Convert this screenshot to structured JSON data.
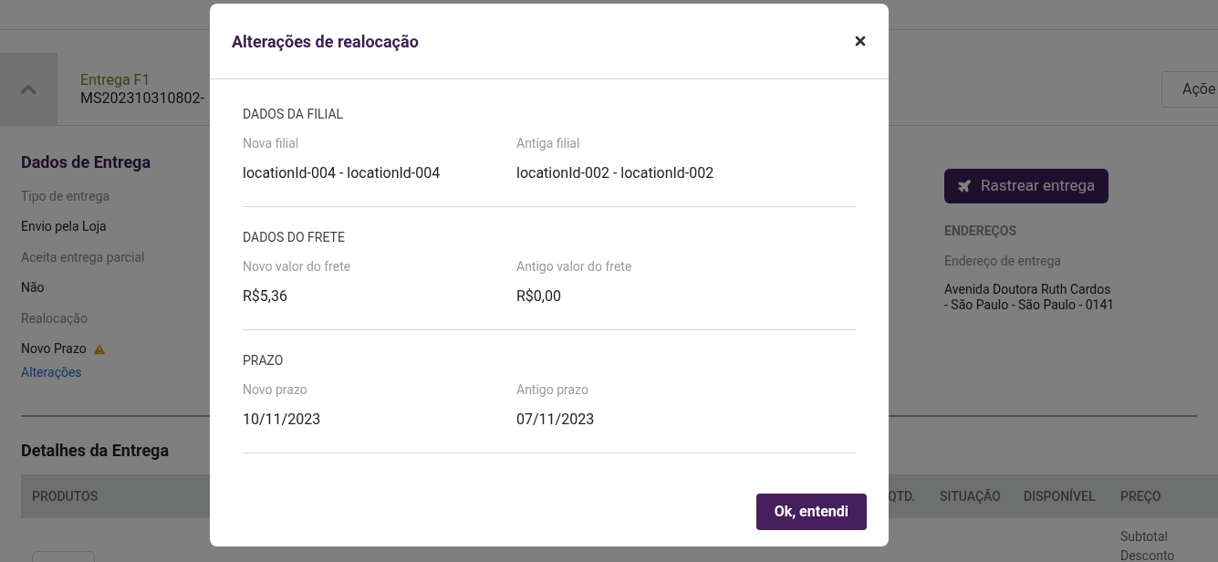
{
  "delivery_header": {
    "title": "Entrega F1",
    "code": "MS202310310802-",
    "expanded": true,
    "actions_button": "Açõe"
  },
  "dados_de_entrega": {
    "heading": "Dados de Entrega",
    "fields": [
      {
        "kind": "text",
        "label": "Tipo de entrega",
        "value": "Envio pela Loja"
      },
      {
        "kind": "text",
        "label": "Aceita entrega parcial",
        "value": "Não"
      },
      {
        "kind": "warning",
        "label": "Realocação",
        "value": "Novo Prazo",
        "link": "Alterações"
      }
    ]
  },
  "tracking": {
    "button": "Rastrear entrega",
    "addresses_heading": "ENDEREÇOS",
    "address_label": "Endereço de entrega",
    "address_lines": [
      "Avenida Doutora Ruth Cardos",
      "- São Paulo - São Paulo - 0141"
    ]
  },
  "detalhes": {
    "heading": "Detalhes da Entrega",
    "columns": [
      "PRODUTOS",
      "QTD.",
      "SITUAÇÃO",
      "DISPONÍVEL",
      "PREÇO"
    ],
    "price_lines": [
      "Subtotal",
      "Desconto"
    ]
  },
  "dialog": {
    "title": "Alterações de realocação",
    "sections": [
      {
        "heading": "DADOS DA FILIAL",
        "items": [
          {
            "label": "Nova filial",
            "value": "locationId-004 - locationId-004"
          },
          {
            "label": "Antiga filial",
            "value": "locationId-002 - locationId-002"
          }
        ]
      },
      {
        "heading": "DADOS DO FRETE",
        "items": [
          {
            "label": "Novo valor do frete",
            "value": "R$5,36"
          },
          {
            "label": "Antigo valor do frete",
            "value": "R$0,00"
          }
        ]
      },
      {
        "heading": "PRAZO",
        "items": [
          {
            "label": "Novo prazo",
            "value": "10/11/2023"
          },
          {
            "label": "Antigo prazo",
            "value": "07/11/2023"
          }
        ]
      }
    ],
    "confirm_button": "Ok, entendi"
  }
}
